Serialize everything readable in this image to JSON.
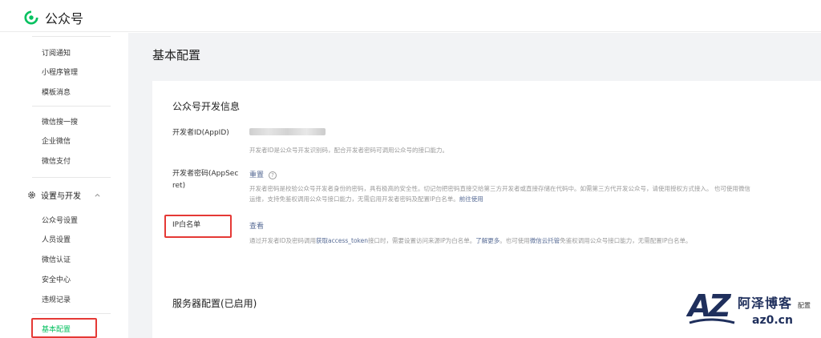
{
  "app": {
    "brand": "公众号",
    "brand_color": "#07c160"
  },
  "sidebar": {
    "items_top": [
      "订阅通知",
      "小程序管理",
      "模板消息",
      "微信搜一搜",
      "企业微信",
      "微信支付"
    ],
    "group": {
      "label": "设置与开发",
      "icon": "gear-icon",
      "state": "expanded"
    },
    "sub_items": [
      "公众号设置",
      "人员设置",
      "微信认证",
      "安全中心",
      "违规记录"
    ],
    "active_item": "基本配置"
  },
  "main": {
    "page_title": "基本配置",
    "dev_info": {
      "title": "公众号开发信息",
      "appid_label": "开发者ID(AppID)",
      "appid_desc": "开发者ID是公众号开发识别码，配合开发者密码可调用公众号的接口能力。",
      "secret_label_1": "开发者密码(AppSec",
      "secret_label_2": "ret)",
      "secret_action": "重置",
      "secret_desc_1": "开发者密码是校验公众号开发者身份的密码，具有极高的安全性。切记勿把密码直接交给第三方开发者或直接存储在代码中。如需第三方代开发公众号，请使用授权方式接入。 也可使用微信",
      "secret_desc_2": "运维，支持免鉴权调用公众号接口能力，无需启用开发者密码及配置IP白名单。",
      "secret_desc_link": "前往使用",
      "ip_label": "IP白名单",
      "ip_action": "查看",
      "ip_desc_a": "通过开发者ID及密码调用",
      "ip_desc_b": "获取access_token",
      "ip_desc_c": "接口时，需要设置访问来源IP为白名单。",
      "ip_desc_d": "了解更多",
      "ip_desc_e": "。也可使用",
      "ip_desc_f": "微信云托管",
      "ip_desc_g": "免鉴权调用公众号接口能力，无需配置IP白名单。"
    },
    "server": {
      "title": "服务器配置(已启用)",
      "tail": "配置"
    }
  },
  "watermark": {
    "logo": "AZ",
    "name": "阿泽博客",
    "domain": "az0.cn"
  }
}
